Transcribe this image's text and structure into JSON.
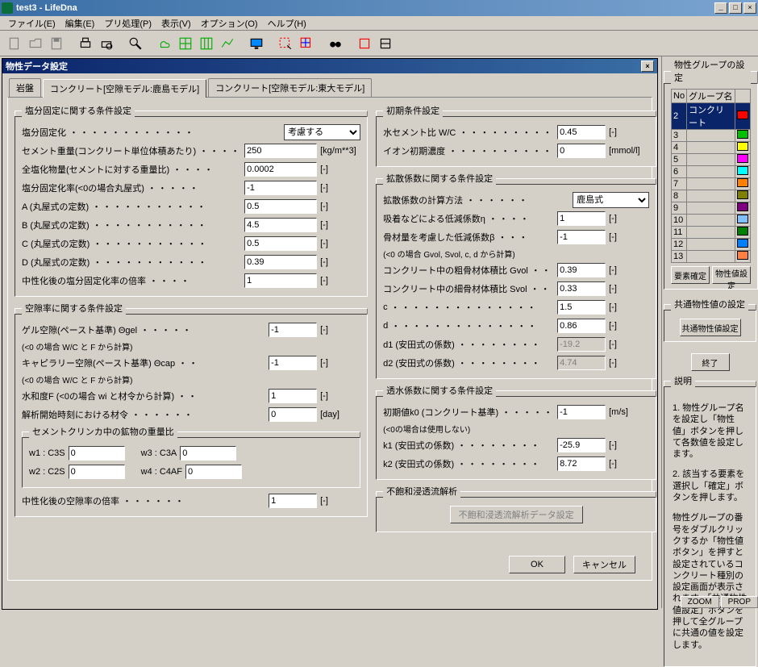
{
  "window": {
    "title": "test3 - LifeDna"
  },
  "menu": [
    "ファイル(E)",
    "編集(E)",
    "プリ処理(P)",
    "表示(V)",
    "オプション(O)",
    "ヘルプ(H)"
  ],
  "dialog": {
    "title": "物性データ設定",
    "tabs": [
      "岩盤",
      "コンクリート[空隙モデル:鹿島モデル]",
      "コンクリート[空隙モデル:東大モデル]"
    ],
    "ok": "OK",
    "cancel": "キャンセル"
  },
  "salt_fix": {
    "legend": "塩分固定に関する条件設定",
    "r1": "塩分固定化",
    "r1_val": "考慮する",
    "r2": "セメント重量(コンクリート単位体積あたり)",
    "r2_val": "250",
    "r2_u": "[kg/m**3]",
    "r3": "全塩化物量(セメントに対する重量比)",
    "r3_val": "0.0002",
    "r3_u": "[-]",
    "r4": "塩分固定化率(<0の場合丸屋式)",
    "r4_val": "-1",
    "r4_u": "[-]",
    "r5": "A (丸屋式の定数)",
    "r5_val": "0.5",
    "r5_u": "[-]",
    "r6": "B (丸屋式の定数)",
    "r6_val": "4.5",
    "r6_u": "[-]",
    "r7": "C (丸屋式の定数)",
    "r7_val": "0.5",
    "r7_u": "[-]",
    "r8": "D (丸屋式の定数)",
    "r8_val": "0.39",
    "r8_u": "[-]",
    "r9": "中性化後の塩分固定化率の倍率",
    "r9_val": "1",
    "r9_u": "[-]"
  },
  "void": {
    "legend": "空隙率に関する条件設定",
    "r1": "ゲル空隙(ペースト基準) Θgel",
    "r1n": "(<0 の場合 W/C と F から計算)",
    "r1_val": "-1",
    "r1_u": "[-]",
    "r2": "キャピラリー空隙(ペースト基準) Θcap",
    "r2n": "(<0 の場合 W/C と F から計算)",
    "r2_val": "-1",
    "r2_u": "[-]",
    "r3": "水和度F (<0の場合 wi と材令から計算)",
    "r3_val": "1",
    "r3_u": "[-]",
    "r4": "解析開始時刻における材令",
    "r4_val": "0",
    "r4_u": "[day]",
    "sub_legend": "セメントクリンカ中の鉱物の重量比",
    "w1": "w1 : C3S",
    "w1_val": "0",
    "w2": "w2 : C2S",
    "w2_val": "0",
    "w3": "w3 : C3A",
    "w3_val": "0",
    "w4": "w4 : C4AF",
    "w4_val": "0",
    "r5": "中性化後の空隙率の倍率",
    "r5_val": "1",
    "r5_u": "[-]"
  },
  "init": {
    "legend": "初期条件設定",
    "r1": "水セメント比 W/C",
    "r1_val": "0.45",
    "r1_u": "[-]",
    "r2": "イオン初期濃度",
    "r2_val": "0",
    "r2_u": "[mmol/l]"
  },
  "diff": {
    "legend": "拡散係数に関する条件設定",
    "r1": "拡散係数の計算方法",
    "r1_val": "鹿島式",
    "r2": "吸着などによる低減係数η",
    "r2_val": "1",
    "r2_u": "[-]",
    "r3": "骨材量を考慮した低減係数β",
    "r3n": "(<0 の場合 Gvol, Svol, c, d から計算)",
    "r3_val": "-1",
    "r3_u": "[-]",
    "r4": "コンクリート中の粗骨材体積比 Gvol",
    "r4_val": "0.39",
    "r4_u": "[-]",
    "r5": "コンクリート中の細骨材体積比 Svol",
    "r5_val": "0.33",
    "r5_u": "[-]",
    "r6": "c",
    "r6_val": "1.5",
    "r6_u": "[-]",
    "r7": "d",
    "r7_val": "0.86",
    "r7_u": "[-]",
    "r8": "d1 (安田式の係数)",
    "r8_val": "-19.2",
    "r8_u": "[-]",
    "r9": "d2 (安田式の係数)",
    "r9_val": "4.74",
    "r9_u": "[-]"
  },
  "perm": {
    "legend": "透水係数に関する条件設定",
    "r1": "初期値k0 (コンクリート基準)",
    "r1n": "(<0の場合は使用しない)",
    "r1_val": "-1",
    "r1_u": "[m/s]",
    "r2": "k1 (安田式の係数)",
    "r2_val": "-25.9",
    "r2_u": "[-]",
    "r3": "k2 (安田式の係数)",
    "r3_val": "8.72",
    "r3_u": "[-]"
  },
  "unsat": {
    "legend": "不飽和浸透流解析",
    "btn": "不飽和浸透流解析データ設定"
  },
  "groups": {
    "legend": "物性グループの設定",
    "cols": [
      "No",
      "グループ名"
    ],
    "rows": [
      {
        "no": "2",
        "name": "コンクリート",
        "c": "#ff0000"
      },
      {
        "no": "3",
        "name": "",
        "c": "#00c000"
      },
      {
        "no": "4",
        "name": "",
        "c": "#ffff00"
      },
      {
        "no": "5",
        "name": "",
        "c": "#ff00ff"
      },
      {
        "no": "6",
        "name": "",
        "c": "#00ffff"
      },
      {
        "no": "7",
        "name": "",
        "c": "#ff8000"
      },
      {
        "no": "8",
        "name": "",
        "c": "#808000"
      },
      {
        "no": "9",
        "name": "",
        "c": "#800080"
      },
      {
        "no": "10",
        "name": "",
        "c": "#80c0ff"
      },
      {
        "no": "11",
        "name": "",
        "c": "#008000"
      },
      {
        "no": "12",
        "name": "",
        "c": "#0080ff"
      },
      {
        "no": "13",
        "name": "",
        "c": "#ff8040"
      }
    ],
    "b1": "要素確定",
    "b2": "物性値設定"
  },
  "common": {
    "legend": "共通物性値の設定",
    "btn": "共通物性値設定",
    "exit": "終了"
  },
  "explain": {
    "legend": "説明",
    "p1": "1. 物性グループ名を設定し「物性値」ボタンを押して各数値を設定します。",
    "p2": "2. 該当する要素を選択し「確定」ボタンを押します。",
    "p3": "物性グループの番号をダブルクリックするか「物性値ボタン」を押すと設定されているコンクリート種別の設定画面が表示されます。「共通物性値設定」ボタンを押して全グループに共通の値を設定します。"
  },
  "status": [
    "ZOOM",
    "PROP"
  ]
}
